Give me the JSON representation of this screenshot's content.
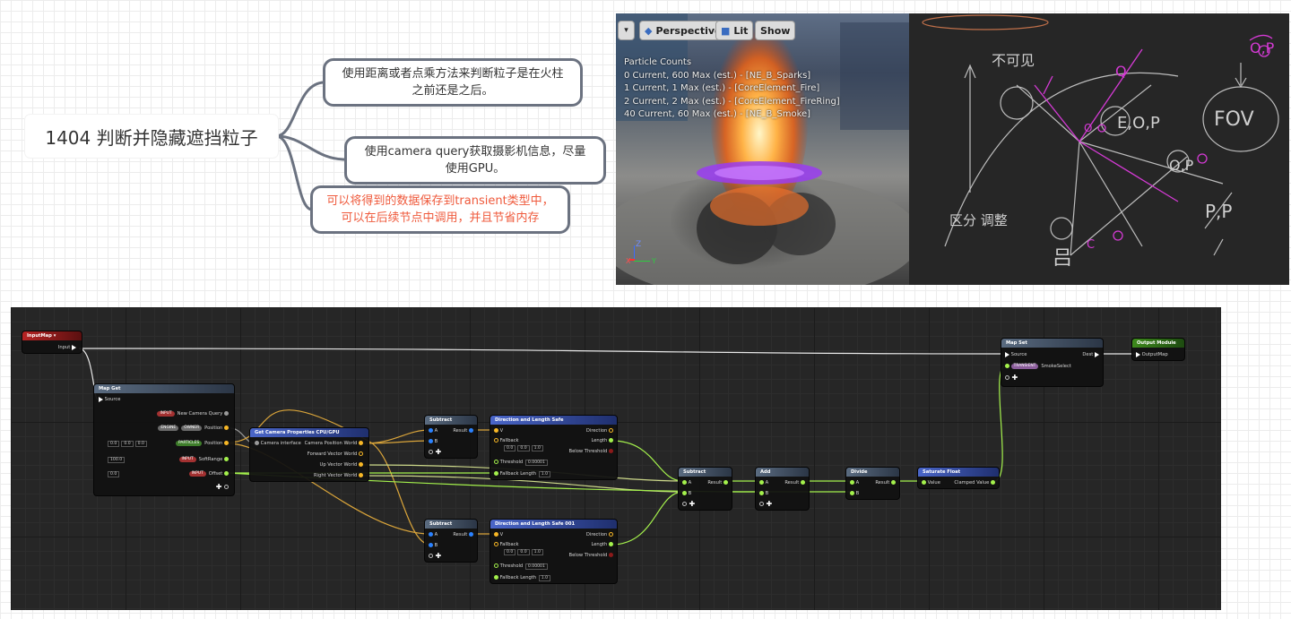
{
  "mindmap": {
    "root": "1404 判断并隐藏遮挡粒子",
    "branches": [
      {
        "text": "使用距离或者点乘方法来判断粒子是在火柱之前还是之后。",
        "highlight": false
      },
      {
        "text": "使用camera query获取摄影机信息，尽量使用GPU。",
        "highlight": false
      },
      {
        "text": "可以将得到的数据保存到transient类型中，可以在后续节点中调用，并且节省内存",
        "highlight": true
      }
    ],
    "highlight_color": "#ef5a3c"
  },
  "viewport": {
    "buttons": {
      "perspective": "Perspective",
      "lit": "Lit",
      "show": "Show"
    },
    "stats_title": "Particle Counts",
    "stats": [
      "0 Current, 600 Max (est.) - [NE_B_Sparks]",
      "1 Current, 1 Max (est.) - [CoreElement_Fire]",
      "2 Current, 2 Max (est.) - [CoreElement_FireRing]",
      "40 Current, 60 Max (est.) - [NE_B_Smoke]"
    ],
    "axis": {
      "z": "Z",
      "x": "X",
      "y": "Y"
    }
  },
  "whiteboard": {
    "notes": [
      "不可见",
      "E,O,P",
      "FOV",
      "O,P",
      "P,P",
      "区分 调整",
      "Q",
      "O",
      "吕",
      "C"
    ],
    "ink_white": "#c8c8c8",
    "ink_magenta": "#d43ad4"
  },
  "graph": {
    "nodes": {
      "input_map": {
        "title": "InputMap",
        "pin": "Input"
      },
      "map_get": {
        "title": "Map Get",
        "source": "Source",
        "pins": [
          {
            "tags": [
              "INPUT"
            ],
            "label": "New Camera Query"
          },
          {
            "tags": [
              "ENGINE",
              "OWNER"
            ],
            "label": "Position"
          },
          {
            "tags": [
              "PARTICLES"
            ],
            "label": "Position"
          },
          {
            "tags": [
              "INPUT"
            ],
            "label": "SoftRange"
          },
          {
            "tags": [
              "INPUT"
            ],
            "label": "Offset"
          }
        ],
        "vector_default": [
          "0.0",
          "0.0",
          "0.0"
        ],
        "softrange_default": "100.0",
        "offset_default": "0.0"
      },
      "camera": {
        "title": "Get Camera Properties CPU/GPU",
        "input": "Camera interface",
        "outputs": [
          "Camera Position World",
          "Forward Vector World",
          "Up Vector World",
          "Right Vector World"
        ]
      },
      "subtract_top": {
        "title": "Subtract",
        "a": "A",
        "b": "B",
        "result": "Result"
      },
      "subtract_bottom": {
        "title": "Subtract",
        "a": "A",
        "b": "B",
        "result": "Result"
      },
      "dls_top": {
        "title": "Direction and Length Safe",
        "v": "V",
        "fallback": "Fallback",
        "fallback_vals": [
          "0.0",
          "0.0",
          "1.0"
        ],
        "threshold": "Threshold",
        "threshold_val": "0.00001",
        "fallback_length": "Fallback Length",
        "fallback_length_val": "1.0",
        "outputs": [
          "Direction",
          "Length",
          "Below Threshold"
        ]
      },
      "dls_bottom": {
        "title": "Direction and Length Safe 001",
        "v": "V",
        "fallback": "Fallback",
        "fallback_vals": [
          "0.0",
          "0.0",
          "1.0"
        ],
        "threshold": "Threshold",
        "threshold_val": "0.00001",
        "fallback_length": "Fallback Length",
        "fallback_length_val": "1.0",
        "outputs": [
          "Direction",
          "Length",
          "Below Threshold"
        ]
      },
      "subtract_mid": {
        "title": "Subtract",
        "a": "A",
        "b": "B",
        "result": "Result"
      },
      "add": {
        "title": "Add",
        "a": "A",
        "b": "B",
        "result": "Result"
      },
      "divide": {
        "title": "Divide",
        "a": "A",
        "b": "B",
        "result": "Result"
      },
      "saturate": {
        "title": "Saturate Float",
        "value": "Value",
        "output": "Clamped Value"
      },
      "map_set": {
        "title": "Map Set",
        "source": "Source",
        "dest": "Dest",
        "tag": "TRANSIENT",
        "label": "SmokeSelect"
      },
      "output_module": {
        "title": "Output Module",
        "pin": "OutputMap"
      }
    }
  }
}
